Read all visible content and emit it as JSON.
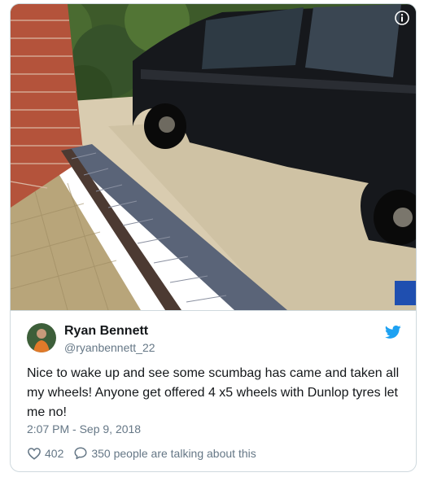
{
  "tweet": {
    "author_name": "Ryan Bennett",
    "author_handle": "@ryanbennett_22",
    "text": "Nice to wake up and see some scumbag has came and taken all my wheels! Anyone get offered 4 x5 wheels with Dunlop tyres let me no!",
    "timestamp": "2:07 PM - Sep 9, 2018",
    "likes": "402",
    "conversation": "350 people are talking about this"
  },
  "icons": {
    "info": "info-icon",
    "brand": "twitter-bird-icon",
    "like": "heart-icon",
    "reply": "speech-bubble-icon"
  },
  "colors": {
    "brand": "#1da1f2",
    "text": "#14171a",
    "muted": "#657786",
    "border": "#cfd9de"
  }
}
